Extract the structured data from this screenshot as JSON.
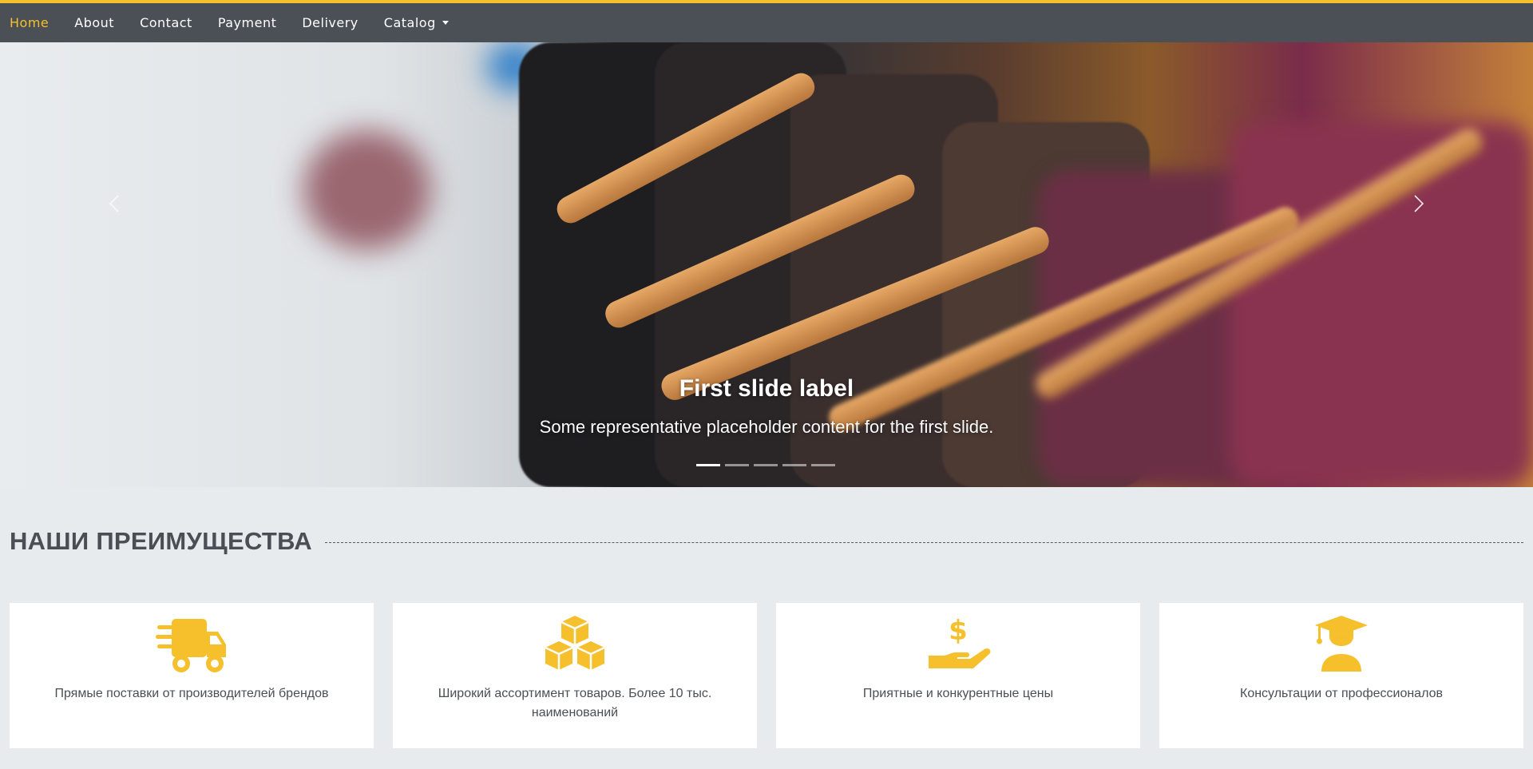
{
  "nav": {
    "items": [
      {
        "label": "Home",
        "active": true
      },
      {
        "label": "About"
      },
      {
        "label": "Contact"
      },
      {
        "label": "Payment"
      },
      {
        "label": "Delivery"
      },
      {
        "label": "Catalog",
        "dropdown": true
      }
    ]
  },
  "carousel": {
    "title": "First slide label",
    "text": "Some representative placeholder content for the first slide.",
    "slide_count": 5,
    "active_slide": 1,
    "prev_icon": "chevron-left-icon",
    "next_icon": "chevron-right-icon"
  },
  "advantages": {
    "heading": "НАШИ ПРЕИМУЩЕСТВА",
    "accent_color": "#f5c02c",
    "items": [
      {
        "icon": "truck-icon",
        "text": "Прямые поставки от производителей брендов"
      },
      {
        "icon": "boxes-icon",
        "text": "Широкий ассортимент товаров. Более 10 тыс. наименований"
      },
      {
        "icon": "hand-dollar-icon",
        "text": "Приятные и конкурентные цены"
      },
      {
        "icon": "graduate-icon",
        "text": "Консультации от профессионалов"
      }
    ]
  }
}
